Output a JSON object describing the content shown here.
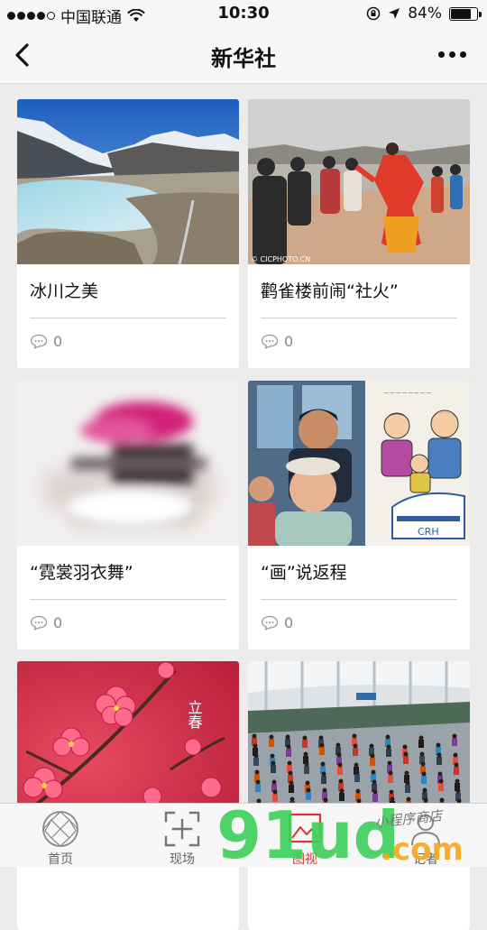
{
  "status_bar": {
    "carrier": "中国联通",
    "time": "10:30",
    "battery": "84%",
    "battery_level": 0.84
  },
  "nav": {
    "title": "新华社"
  },
  "cards": [
    {
      "title": "冰川之美",
      "comments": "0",
      "image_icon": "glacier-lake-photo"
    },
    {
      "title": "鹳雀楼前闹“社火”",
      "comments": "0",
      "image_icon": "festival-crowd-photo",
      "photo_credit": "© CICPHOTO.CN"
    },
    {
      "title": "“霓裳羽衣舞”",
      "comments": "0",
      "image_icon": "motion-blur-dance-photo"
    },
    {
      "title": "“画”说返程",
      "comments": "0",
      "image_icon": "family-and-drawing-photo"
    },
    {
      "title": "",
      "comments": "",
      "image_icon": "plum-blossom-photo",
      "overlay_text": "立春"
    },
    {
      "title": "",
      "comments": "",
      "image_icon": "railway-station-crowd-photo"
    }
  ],
  "tabs": [
    {
      "label": "首页",
      "icon": "geodesic-globe-icon",
      "active": false
    },
    {
      "label": "现场",
      "icon": "plus-frame-icon",
      "active": false
    },
    {
      "label": "图视",
      "icon": "picture-icon",
      "active": true
    },
    {
      "label": "记者",
      "icon": "reporter-icon",
      "active": false
    }
  ],
  "watermark": {
    "text": "91ud.com",
    "subtext": "小程序商店"
  },
  "colors": {
    "accent_active": "#dd3333",
    "background": "#ececec",
    "card": "#ffffff",
    "watermark_green": "#3ecf5a",
    "watermark_orange": "#f5a623"
  }
}
